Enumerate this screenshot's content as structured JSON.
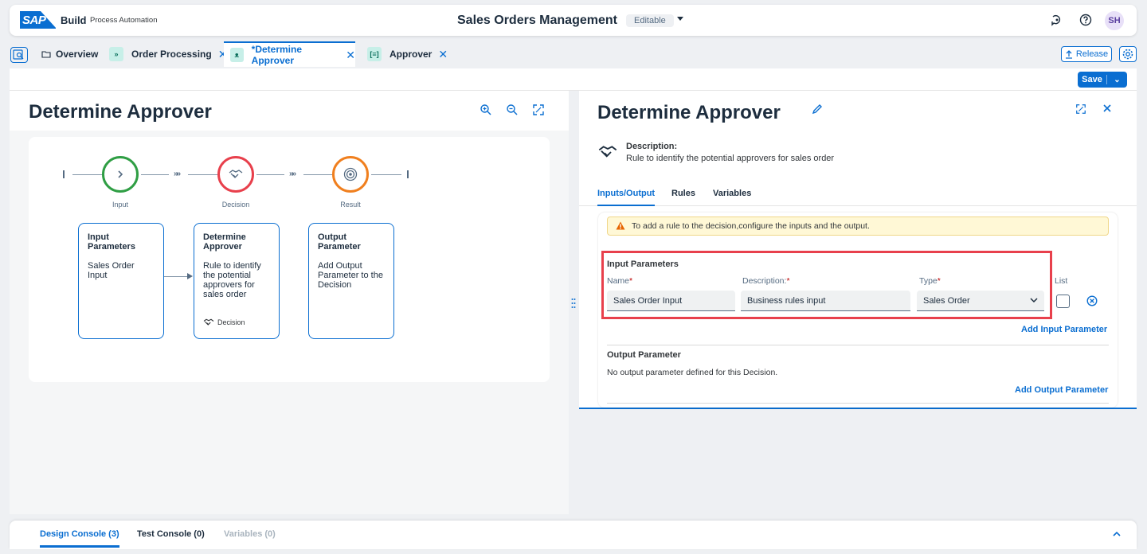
{
  "shell": {
    "logo": "SAP",
    "brand": "Build",
    "brand_sub": "Process Automation",
    "title": "Sales Orders Management",
    "status": "Editable",
    "avatar": "SH"
  },
  "tabs": [
    {
      "label": "Overview"
    },
    {
      "label": "Order Processing"
    },
    {
      "label": "*Determine Approver"
    },
    {
      "label": "Approver"
    }
  ],
  "toolbar": {
    "release": "Release",
    "save": "Save"
  },
  "left": {
    "title": "Determine Approver",
    "nodes": [
      {
        "label": "Input"
      },
      {
        "label": "Decision"
      },
      {
        "label": "Result"
      }
    ],
    "cards": [
      {
        "title": "Input Parameters",
        "text": "Sales Order Input"
      },
      {
        "title": "Determine Approver",
        "text": "Rule to identify the potential approvers for sales order",
        "foot": "Decision"
      },
      {
        "title": "Output Parameter",
        "text": "Add Output Parameter to the Decision"
      }
    ]
  },
  "right": {
    "title": "Determine Approver",
    "desc_label": "Description:",
    "desc_text": "Rule to identify the potential approvers for sales order",
    "subtabs": [
      "Inputs/Output",
      "Rules",
      "Variables"
    ],
    "warning": "To add a rule to the decision,configure the inputs and the output.",
    "input_section": "Input Parameters",
    "labels": {
      "name": "Name",
      "description": "Description:",
      "type": "Type",
      "list": "List"
    },
    "input": {
      "name": "Sales Order Input",
      "description": "Business rules input",
      "type": "Sales Order"
    },
    "add_input": "Add Input Parameter",
    "output_section": "Output Parameter",
    "no_output": "No output parameter defined for this Decision.",
    "add_output": "Add Output Parameter"
  },
  "console": {
    "tabs": [
      "Design Console (3)",
      "Test Console (0)",
      "Variables (0)"
    ]
  },
  "colors": {
    "accent": "#0a6ed1",
    "start": "#2f9e44",
    "decision": "#e8404c",
    "result": "#f07f1e",
    "highlight": "#e8404c"
  }
}
